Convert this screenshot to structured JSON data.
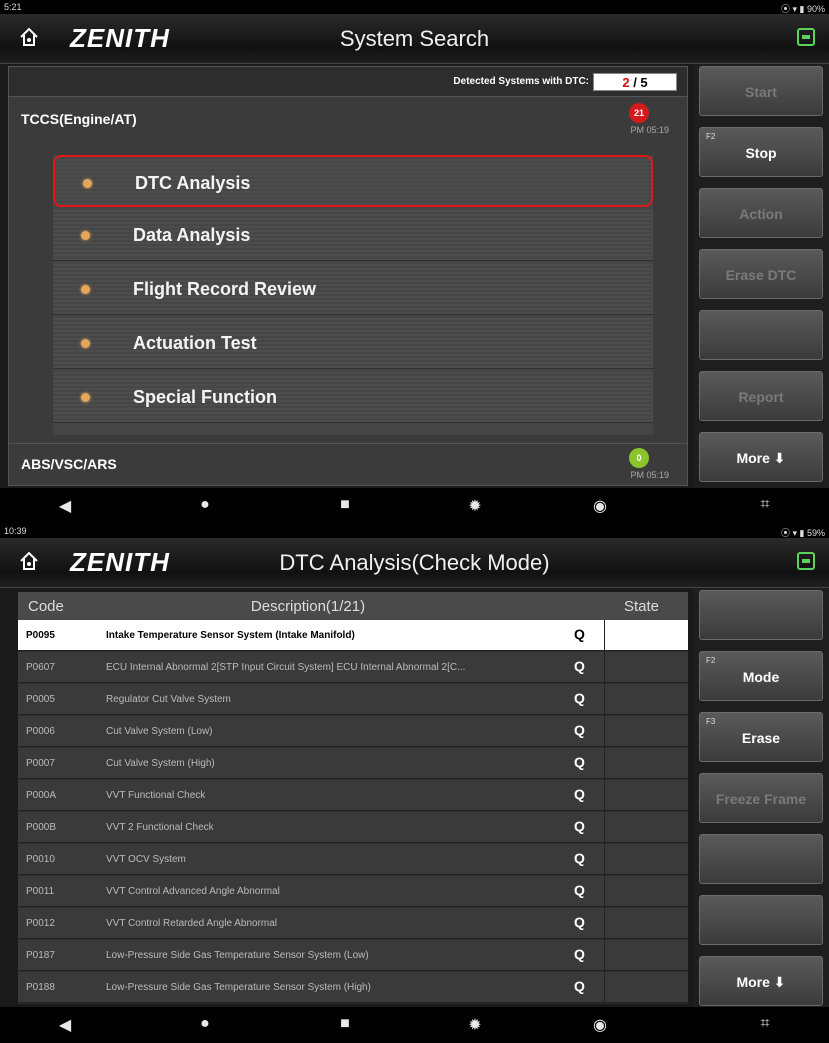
{
  "screen1": {
    "status": {
      "time": "5:21",
      "icons": "⦿ ▾ ▮ 90%"
    },
    "logo": "ZENITH",
    "title": "System Search",
    "dtc_label": "Detected Systems with DTC:",
    "dtc_count_detected": "2",
    "dtc_count_total": " / 5",
    "system1": {
      "name": "TCCS(Engine/AT)",
      "badge": "21",
      "time": "PM 05:19",
      "badge_color": "#d41b1b"
    },
    "menu": [
      {
        "label": "DTC Analysis",
        "selected": true
      },
      {
        "label": "Data Analysis"
      },
      {
        "label": "Flight Record Review"
      },
      {
        "label": "Actuation Test"
      },
      {
        "label": "Special Function"
      }
    ],
    "system2": {
      "name": "ABS/VSC/ARS",
      "badge": "0",
      "time": "PM 05:19",
      "badge_color": "#8ac62a"
    },
    "buttons": [
      {
        "label": "Start",
        "enabled": false,
        "fkey": ""
      },
      {
        "label": "Stop",
        "enabled": true,
        "fkey": "F2"
      },
      {
        "label": "Action",
        "enabled": false,
        "fkey": ""
      },
      {
        "label": "Erase DTC",
        "enabled": false,
        "fkey": ""
      },
      {
        "label": "",
        "enabled": false,
        "fkey": ""
      },
      {
        "label": "Report",
        "enabled": false,
        "fkey": ""
      },
      {
        "label": "More ⬇",
        "enabled": true,
        "fkey": ""
      }
    ]
  },
  "screen2": {
    "status": {
      "time": "10:39",
      "icons": "⦿ ▾ ▮ 59%"
    },
    "logo": "ZENITH",
    "title": "DTC Analysis(Check Mode)",
    "columns": {
      "code": "Code",
      "description": "Description(1/21)",
      "state": "State"
    },
    "rows": [
      {
        "code": "P0095",
        "desc": "Intake Temperature Sensor System (Intake Manifold)",
        "selected": true
      },
      {
        "code": "P0607",
        "desc": "ECU Internal Abnormal 2[STP Input Circuit System] ECU Internal Abnormal 2[C..."
      },
      {
        "code": "P0005",
        "desc": "Regulator Cut Valve System"
      },
      {
        "code": "P0006",
        "desc": "Cut Valve System (Low)"
      },
      {
        "code": "P0007",
        "desc": "Cut Valve System (High)"
      },
      {
        "code": "P000A",
        "desc": "VVT Functional Check"
      },
      {
        "code": "P000B",
        "desc": "VVT 2 Functional Check"
      },
      {
        "code": "P0010",
        "desc": "VVT OCV System"
      },
      {
        "code": "P0011",
        "desc": "VVT Control Advanced Angle Abnormal"
      },
      {
        "code": "P0012",
        "desc": "VVT Control Retarded Angle Abnormal"
      },
      {
        "code": "P0187",
        "desc": "Low-Pressure Side Gas Temperature Sensor System (Low)"
      },
      {
        "code": "P0188",
        "desc": "Low-Pressure Side Gas Temperature Sensor System (High)"
      }
    ],
    "buttons": [
      {
        "label": "",
        "enabled": false,
        "fkey": ""
      },
      {
        "label": "Mode",
        "enabled": true,
        "fkey": "F2"
      },
      {
        "label": "Erase",
        "enabled": true,
        "fkey": "F3"
      },
      {
        "label": "Freeze Frame",
        "enabled": false,
        "fkey": ""
      },
      {
        "label": "",
        "enabled": false,
        "fkey": ""
      },
      {
        "label": "",
        "enabled": false,
        "fkey": ""
      },
      {
        "label": "More ⬇",
        "enabled": true,
        "fkey": ""
      }
    ]
  },
  "colors": {
    "accent_red": "#e01818",
    "menu_dot": "#e3a65a",
    "battery_green": "#5bd35b"
  },
  "icons": {
    "nav": [
      "back-icon",
      "home-dot-icon",
      "recents-icon",
      "settings-gear-icon",
      "vci-icon",
      "screenshot-icon"
    ],
    "header": [
      "home-icon",
      "battery-icon"
    ],
    "table_action": "search-icon"
  }
}
